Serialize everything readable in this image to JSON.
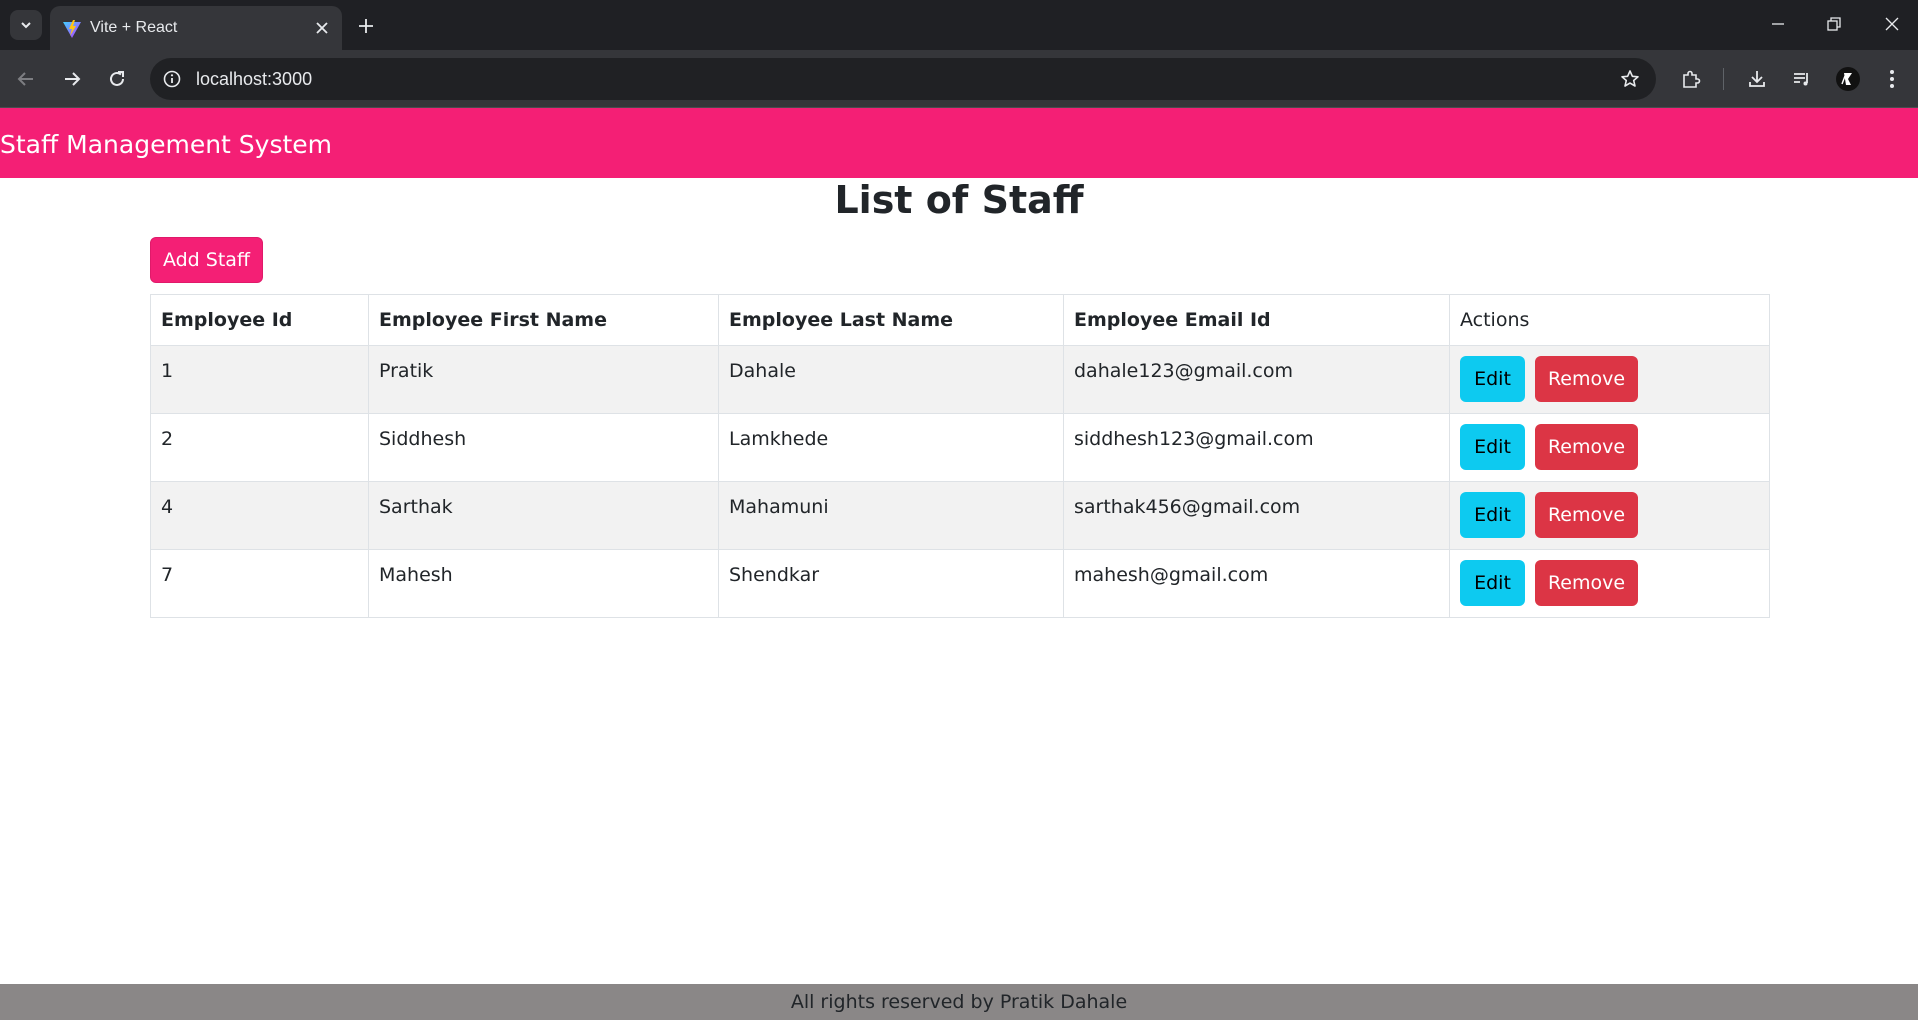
{
  "browser": {
    "tab": {
      "title": "Vite + React"
    },
    "address": {
      "url": "localhost:3000"
    }
  },
  "header": {
    "brand": "Staff Management System",
    "color": "#f41f75"
  },
  "main": {
    "title": "List of Staff",
    "add_button_label": "Add Staff",
    "table": {
      "columns": [
        "Employee Id",
        "Employee First Name",
        "Employee Last Name",
        "Employee Email Id",
        "Actions"
      ],
      "rows": [
        {
          "id": "1",
          "first_name": "Pratik",
          "last_name": "Dahale",
          "email": "dahale123@gmail.com"
        },
        {
          "id": "2",
          "first_name": "Siddhesh",
          "last_name": "Lamkhede",
          "email": "siddhesh123@gmail.com"
        },
        {
          "id": "4",
          "first_name": "Sarthak",
          "last_name": "Mahamuni",
          "email": "sarthak456@gmail.com"
        },
        {
          "id": "7",
          "first_name": "Mahesh",
          "last_name": "Shendkar",
          "email": "mahesh@gmail.com"
        }
      ],
      "edit_label": "Edit",
      "remove_label": "Remove"
    }
  },
  "footer": {
    "text": "All rights reserved by Pratik Dahale"
  },
  "icons": {
    "tab_search": "chevron-down-icon",
    "favicon": "vite-logo-icon",
    "close": "close-icon",
    "new_tab": "plus-icon",
    "back": "arrow-left-icon",
    "forward": "arrow-right-icon",
    "reload": "reload-icon",
    "info": "info-icon",
    "bookmark": "star-icon",
    "extensions": "puzzle-icon",
    "downloads": "download-icon",
    "media": "playlist-icon",
    "profile": "profile-avatar-icon",
    "menu": "more-vert-icon"
  }
}
